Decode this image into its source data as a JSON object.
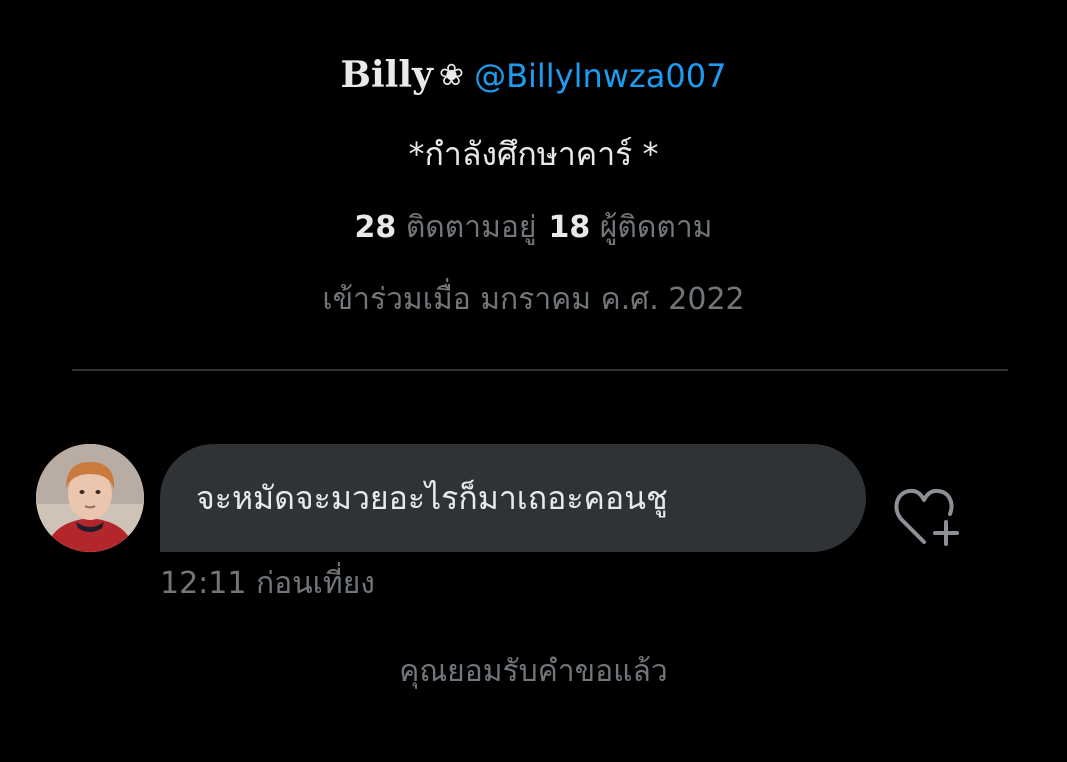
{
  "profile": {
    "display_name": "Billy",
    "flower_glyph": "❀",
    "handle": "@Billylnwza007",
    "bio": "*กำลังศึกษาคาร์ *",
    "following_count": "28",
    "following_label": "ติดตามอยู่",
    "followers_count": "18",
    "followers_label": "ผู้ติดตาม",
    "joined": "เข้าร่วมเมื่อ มกราคม ค.ศ. 2022"
  },
  "conversation": {
    "messages": [
      {
        "text": "จะหมัดจะมวยอะไรก็มาเถอะคอนชู",
        "time": "12:11 ก่อนเที่ยง"
      }
    ],
    "status": "คุณยอมรับคำขอแล้ว"
  },
  "icons": {
    "react": "heart-plus-icon",
    "avatar": "avatar"
  },
  "colors": {
    "background": "#000000",
    "text": "#e7e9ea",
    "muted": "#71767b",
    "link": "#1d9bf0",
    "bubble": "#2f3336",
    "divider": "#2f3336"
  }
}
